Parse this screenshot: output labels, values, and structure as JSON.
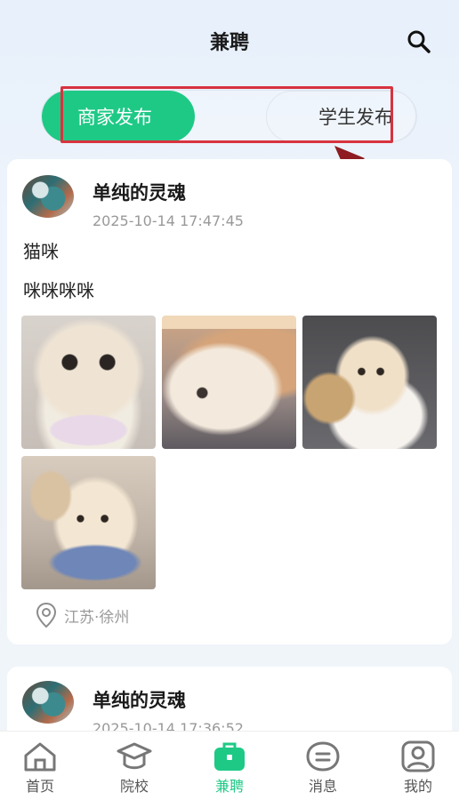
{
  "header": {
    "title": "兼聘",
    "search_icon": "search-icon"
  },
  "tabs": {
    "active_label": "商家发布",
    "inactive_label": "学生发布",
    "accent": "#1ec986"
  },
  "posts": [
    {
      "username": "单纯的灵魂",
      "time": "2025-10-14 17:47:45",
      "title": "猫咪",
      "body": "咪咪咪咪",
      "photo_count": 4,
      "location": "江苏·徐州"
    },
    {
      "username": "单纯的灵魂",
      "time": "2025-10-14 17:36:52"
    }
  ],
  "bottom_nav": [
    {
      "label": "首页",
      "icon": "home-icon"
    },
    {
      "label": "院校",
      "icon": "graduation-cap-icon"
    },
    {
      "label": "兼聘",
      "icon": "briefcase-icon",
      "active": true
    },
    {
      "label": "消息",
      "icon": "message-icon"
    },
    {
      "label": "我的",
      "icon": "profile-icon"
    }
  ],
  "annotation_color": "#d7333f"
}
